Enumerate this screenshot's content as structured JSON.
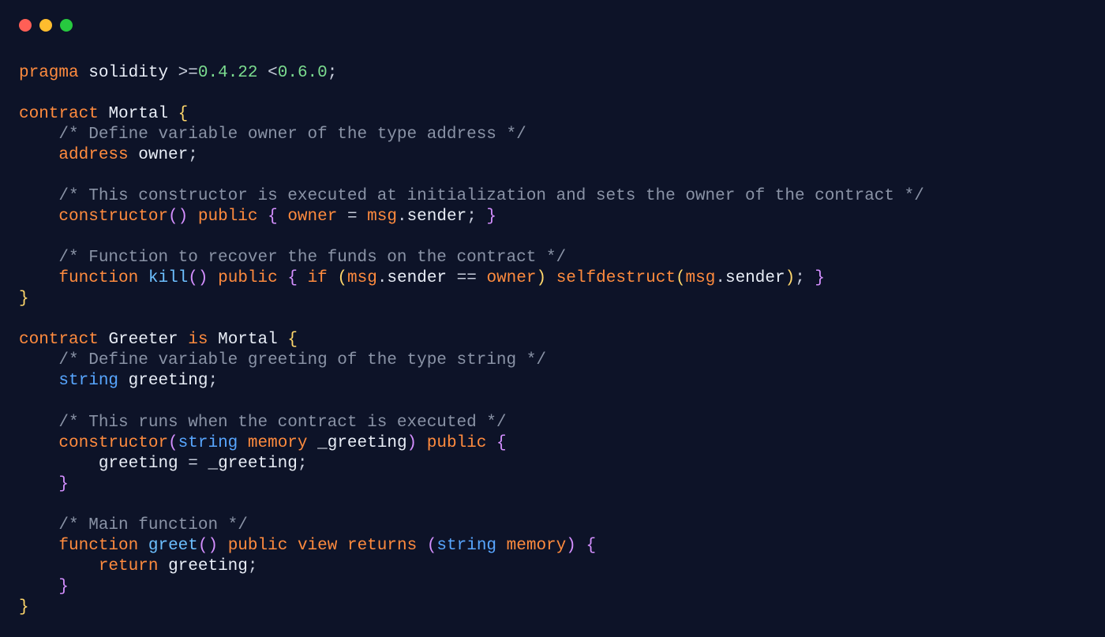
{
  "colors": {
    "bg": "#0d1328",
    "keyword": "#ff8b3e",
    "string_kw": "#58a6ff",
    "ident": "#e9eef7",
    "fn": "#6dc0ff",
    "comment": "#8a93a6",
    "num": "#7bdc8f",
    "brace": "#ffd76b",
    "paren2": "#d48fff"
  },
  "traffic_lights": [
    "close",
    "minimize",
    "maximize"
  ],
  "code_lines": [
    [
      {
        "c": "kw",
        "t": "pragma"
      },
      {
        "c": "op",
        "t": " "
      },
      {
        "c": "ident",
        "t": "solidity"
      },
      {
        "c": "op",
        "t": " "
      },
      {
        "c": "gt",
        "t": ">="
      },
      {
        "c": "num",
        "t": "0.4.22"
      },
      {
        "c": "op",
        "t": " "
      },
      {
        "c": "gt",
        "t": "<"
      },
      {
        "c": "num",
        "t": "0.6.0"
      },
      {
        "c": "op",
        "t": ";"
      }
    ],
    [],
    [
      {
        "c": "kw",
        "t": "contract"
      },
      {
        "c": "op",
        "t": " "
      },
      {
        "c": "ident",
        "t": "Mortal"
      },
      {
        "c": "op",
        "t": " "
      },
      {
        "c": "paren",
        "t": "{"
      }
    ],
    [
      {
        "c": "op",
        "t": "    "
      },
      {
        "c": "comment",
        "t": "/* Define variable owner of the type address */"
      }
    ],
    [
      {
        "c": "op",
        "t": "    "
      },
      {
        "c": "kw",
        "t": "address"
      },
      {
        "c": "op",
        "t": " "
      },
      {
        "c": "ident",
        "t": "owner"
      },
      {
        "c": "op",
        "t": ";"
      }
    ],
    [],
    [
      {
        "c": "op",
        "t": "    "
      },
      {
        "c": "comment",
        "t": "/* This constructor is executed at initialization and sets the owner of the contract */"
      }
    ],
    [
      {
        "c": "op",
        "t": "    "
      },
      {
        "c": "kw",
        "t": "constructor"
      },
      {
        "c": "paren2",
        "t": "()"
      },
      {
        "c": "op",
        "t": " "
      },
      {
        "c": "kw",
        "t": "public"
      },
      {
        "c": "op",
        "t": " "
      },
      {
        "c": "paren2",
        "t": "{"
      },
      {
        "c": "op",
        "t": " "
      },
      {
        "c": "msg",
        "t": "owner"
      },
      {
        "c": "op",
        "t": " = "
      },
      {
        "c": "msg",
        "t": "msg"
      },
      {
        "c": "op",
        "t": "."
      },
      {
        "c": "sender",
        "t": "sender"
      },
      {
        "c": "op",
        "t": "; "
      },
      {
        "c": "paren2",
        "t": "}"
      }
    ],
    [],
    [
      {
        "c": "op",
        "t": "    "
      },
      {
        "c": "comment",
        "t": "/* Function to recover the funds on the contract */"
      }
    ],
    [
      {
        "c": "op",
        "t": "    "
      },
      {
        "c": "kw",
        "t": "function"
      },
      {
        "c": "op",
        "t": " "
      },
      {
        "c": "fn",
        "t": "kill"
      },
      {
        "c": "paren2",
        "t": "()"
      },
      {
        "c": "op",
        "t": " "
      },
      {
        "c": "kw",
        "t": "public"
      },
      {
        "c": "op",
        "t": " "
      },
      {
        "c": "paren2",
        "t": "{"
      },
      {
        "c": "op",
        "t": " "
      },
      {
        "c": "kw",
        "t": "if"
      },
      {
        "c": "op",
        "t": " "
      },
      {
        "c": "paren",
        "t": "("
      },
      {
        "c": "msg",
        "t": "msg"
      },
      {
        "c": "op",
        "t": "."
      },
      {
        "c": "sender",
        "t": "sender"
      },
      {
        "c": "op",
        "t": " == "
      },
      {
        "c": "msg",
        "t": "owner"
      },
      {
        "c": "paren",
        "t": ")"
      },
      {
        "c": "op",
        "t": " "
      },
      {
        "c": "kw",
        "t": "selfdestruct"
      },
      {
        "c": "paren",
        "t": "("
      },
      {
        "c": "msg",
        "t": "msg"
      },
      {
        "c": "op",
        "t": "."
      },
      {
        "c": "sender",
        "t": "sender"
      },
      {
        "c": "paren",
        "t": ")"
      },
      {
        "c": "op",
        "t": "; "
      },
      {
        "c": "paren2",
        "t": "}"
      }
    ],
    [
      {
        "c": "paren",
        "t": "}"
      }
    ],
    [],
    [
      {
        "c": "kw",
        "t": "contract"
      },
      {
        "c": "op",
        "t": " "
      },
      {
        "c": "ident",
        "t": "Greeter"
      },
      {
        "c": "op",
        "t": " "
      },
      {
        "c": "kw",
        "t": "is"
      },
      {
        "c": "op",
        "t": " "
      },
      {
        "c": "ident",
        "t": "Mortal"
      },
      {
        "c": "op",
        "t": " "
      },
      {
        "c": "paren",
        "t": "{"
      }
    ],
    [
      {
        "c": "op",
        "t": "    "
      },
      {
        "c": "comment",
        "t": "/* Define variable greeting of the type string */"
      }
    ],
    [
      {
        "c": "op",
        "t": "    "
      },
      {
        "c": "kw-blue",
        "t": "string"
      },
      {
        "c": "op",
        "t": " "
      },
      {
        "c": "ident",
        "t": "greeting"
      },
      {
        "c": "op",
        "t": ";"
      }
    ],
    [],
    [
      {
        "c": "op",
        "t": "    "
      },
      {
        "c": "comment",
        "t": "/* This runs when the contract is executed */"
      }
    ],
    [
      {
        "c": "op",
        "t": "    "
      },
      {
        "c": "kw",
        "t": "constructor"
      },
      {
        "c": "paren2",
        "t": "("
      },
      {
        "c": "kw-blue",
        "t": "string"
      },
      {
        "c": "op",
        "t": " "
      },
      {
        "c": "kw",
        "t": "memory"
      },
      {
        "c": "op",
        "t": " "
      },
      {
        "c": "ident",
        "t": "_greeting"
      },
      {
        "c": "paren2",
        "t": ")"
      },
      {
        "c": "op",
        "t": " "
      },
      {
        "c": "kw",
        "t": "public"
      },
      {
        "c": "op",
        "t": " "
      },
      {
        "c": "paren2",
        "t": "{"
      }
    ],
    [
      {
        "c": "op",
        "t": "        "
      },
      {
        "c": "ident",
        "t": "greeting"
      },
      {
        "c": "op",
        "t": " = "
      },
      {
        "c": "ident",
        "t": "_greeting"
      },
      {
        "c": "op",
        "t": ";"
      }
    ],
    [
      {
        "c": "op",
        "t": "    "
      },
      {
        "c": "paren2",
        "t": "}"
      }
    ],
    [],
    [
      {
        "c": "op",
        "t": "    "
      },
      {
        "c": "comment",
        "t": "/* Main function */"
      }
    ],
    [
      {
        "c": "op",
        "t": "    "
      },
      {
        "c": "kw",
        "t": "function"
      },
      {
        "c": "op",
        "t": " "
      },
      {
        "c": "fn",
        "t": "greet"
      },
      {
        "c": "paren2",
        "t": "()"
      },
      {
        "c": "op",
        "t": " "
      },
      {
        "c": "kw",
        "t": "public"
      },
      {
        "c": "op",
        "t": " "
      },
      {
        "c": "kw",
        "t": "view"
      },
      {
        "c": "op",
        "t": " "
      },
      {
        "c": "kw",
        "t": "returns"
      },
      {
        "c": "op",
        "t": " "
      },
      {
        "c": "paren2",
        "t": "("
      },
      {
        "c": "kw-blue",
        "t": "string"
      },
      {
        "c": "op",
        "t": " "
      },
      {
        "c": "kw",
        "t": "memory"
      },
      {
        "c": "paren2",
        "t": ")"
      },
      {
        "c": "op",
        "t": " "
      },
      {
        "c": "paren2",
        "t": "{"
      }
    ],
    [
      {
        "c": "op",
        "t": "        "
      },
      {
        "c": "kw",
        "t": "return"
      },
      {
        "c": "op",
        "t": " "
      },
      {
        "c": "ident",
        "t": "greeting"
      },
      {
        "c": "op",
        "t": ";"
      }
    ],
    [
      {
        "c": "op",
        "t": "    "
      },
      {
        "c": "paren2",
        "t": "}"
      }
    ],
    [
      {
        "c": "paren",
        "t": "}"
      }
    ]
  ]
}
